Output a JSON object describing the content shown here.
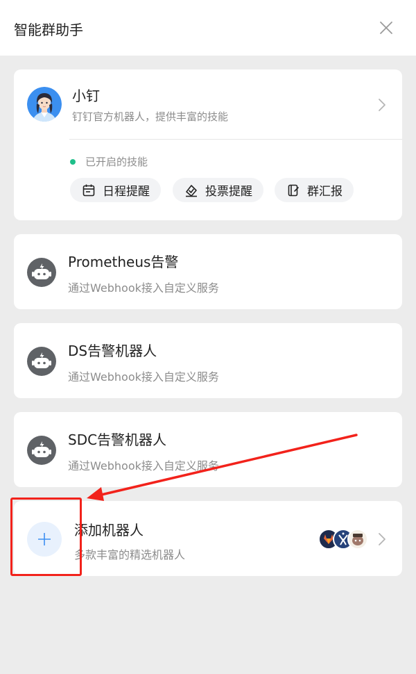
{
  "header": {
    "title": "智能群助手",
    "close_icon": "close-icon"
  },
  "main_bot": {
    "name": "小钉",
    "description": "钉钉官方机器人，提供丰富的技能",
    "skills_status": "已开启的技能",
    "status_color": "#1fbf8a",
    "skills": [
      {
        "label": "日程提醒",
        "icon": "calendar-icon"
      },
      {
        "label": "投票提醒",
        "icon": "vote-icon"
      },
      {
        "label": "群汇报",
        "icon": "report-icon"
      }
    ]
  },
  "bots": [
    {
      "name": "Prometheus告警",
      "description": "通过Webhook接入自定义服务",
      "icon": "robot-icon"
    },
    {
      "name": "DS告警机器人",
      "description": "通过Webhook接入自定义服务",
      "icon": "robot-icon"
    },
    {
      "name": "SDC告警机器人",
      "description": "通过Webhook接入自定义服务",
      "icon": "robot-icon"
    }
  ],
  "add_bot": {
    "title": "添加机器人",
    "description": "多款丰富的精选机器人",
    "icon": "plus-icon",
    "avatars": [
      "gitlab-avatar",
      "jenkins-avatar",
      "mascot-avatar"
    ]
  },
  "colors": {
    "background": "#ececec",
    "card": "#ffffff",
    "accent_blue": "#3d8ff2",
    "annotation_red": "#f2221b"
  }
}
